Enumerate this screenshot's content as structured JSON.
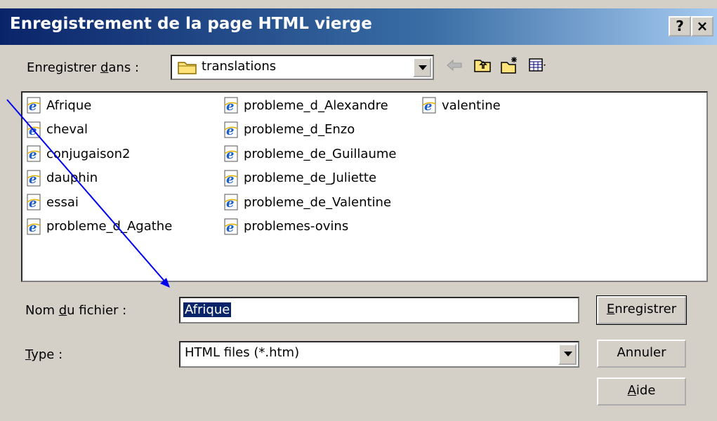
{
  "window": {
    "title": "Enregistrement de la page HTML vierge",
    "help_button": "?",
    "close_button": "×"
  },
  "location": {
    "label": "Enregistrer dans :",
    "label_parts": [
      "Enregistrer ",
      "d",
      "ans :"
    ],
    "folder": "translations"
  },
  "files": {
    "columns": [
      [
        "Afrique",
        "cheval",
        "conjugaison2",
        "dauphin",
        "essai",
        "probleme_d_Agathe"
      ],
      [
        "probleme_d_Alexandre",
        "probleme_d_Enzo",
        "probleme_de_Guillaume",
        "probleme_de_Juliette",
        "probleme_de_Valentine",
        "problemes-ovins"
      ],
      [
        "valentine"
      ]
    ]
  },
  "filename": {
    "label": "Nom du fichier :",
    "label_parts": [
      "Nom ",
      "d",
      "u fichier :"
    ],
    "value": "Afrique"
  },
  "filetype": {
    "label": "Type :",
    "label_parts": [
      "",
      "T",
      "ype :"
    ],
    "value": "HTML files (*.htm)"
  },
  "buttons": {
    "save": "Enregistrer",
    "save_parts": [
      "",
      "E",
      "nregistrer"
    ],
    "cancel": "Annuler",
    "help": "Aide",
    "help_parts": [
      "",
      "A",
      "ide"
    ]
  },
  "colors": {
    "titlebar": "#0a246a",
    "dialog_bg": "#d4d0c8",
    "selection": "#0a246a",
    "annotation_arrow": "#0000ee"
  }
}
